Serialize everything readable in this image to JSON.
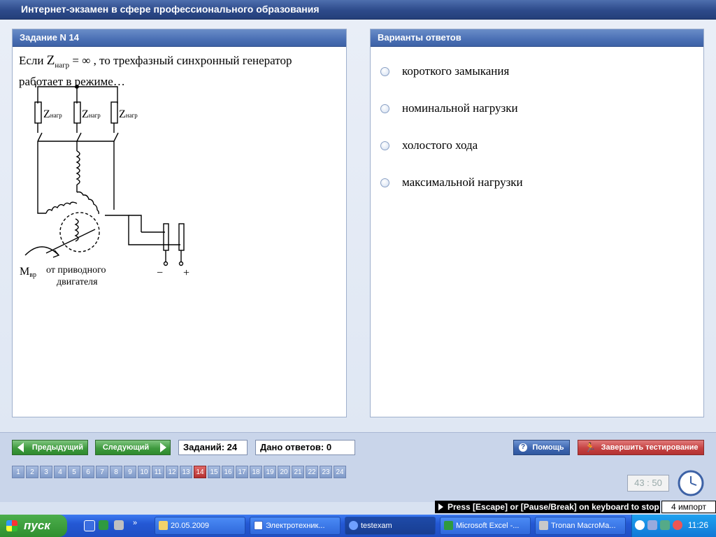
{
  "window": {
    "title": "Интернет-экзамен в сфере профессионального образования"
  },
  "task": {
    "header": "Задание N 14",
    "question_prefix": "Если",
    "z_symbol": "Z",
    "z_sub": "нагр",
    "question_mid": " = ∞ , то трехфазный синхронный генератор",
    "question_line2": "работает в режиме…",
    "diagram": {
      "load_label": "Z",
      "load_sub": "нагр",
      "torque_label": "M",
      "torque_sub": "вр",
      "drive_label_1": "от приводного",
      "drive_label_2": "двигателя",
      "minus": "−",
      "plus": "+"
    }
  },
  "answers": {
    "header": "Варианты ответов",
    "options": [
      "короткого замыкания",
      "номинальной нагрузки",
      "холостого хода",
      "максимальной нагрузки"
    ]
  },
  "nav": {
    "prev_label": "Предыдущий",
    "next_label": "Следующий",
    "tasks_total": "Заданий: 24",
    "answers_given": "Дано ответов: 0",
    "help_label": "Помощь",
    "finish_label": "Завершить тестирование",
    "pages": [
      "1",
      "2",
      "3",
      "4",
      "5",
      "6",
      "7",
      "8",
      "9",
      "10",
      "11",
      "12",
      "13",
      "14",
      "15",
      "16",
      "17",
      "18",
      "19",
      "20",
      "21",
      "22",
      "23",
      "24"
    ],
    "current_page": 14,
    "timer": "43 : 50"
  },
  "hint": {
    "escape_text": "Press [Escape] or [Pause/Break] on keyboard to stop",
    "import_text": "4 импорт"
  },
  "taskbar": {
    "start_label": "пуск",
    "items": [
      "20.05.2009",
      "Электротехник...",
      "testexam",
      "Microsoft Excel -...",
      "Tronan MacroMa..."
    ],
    "time": "11:26"
  }
}
